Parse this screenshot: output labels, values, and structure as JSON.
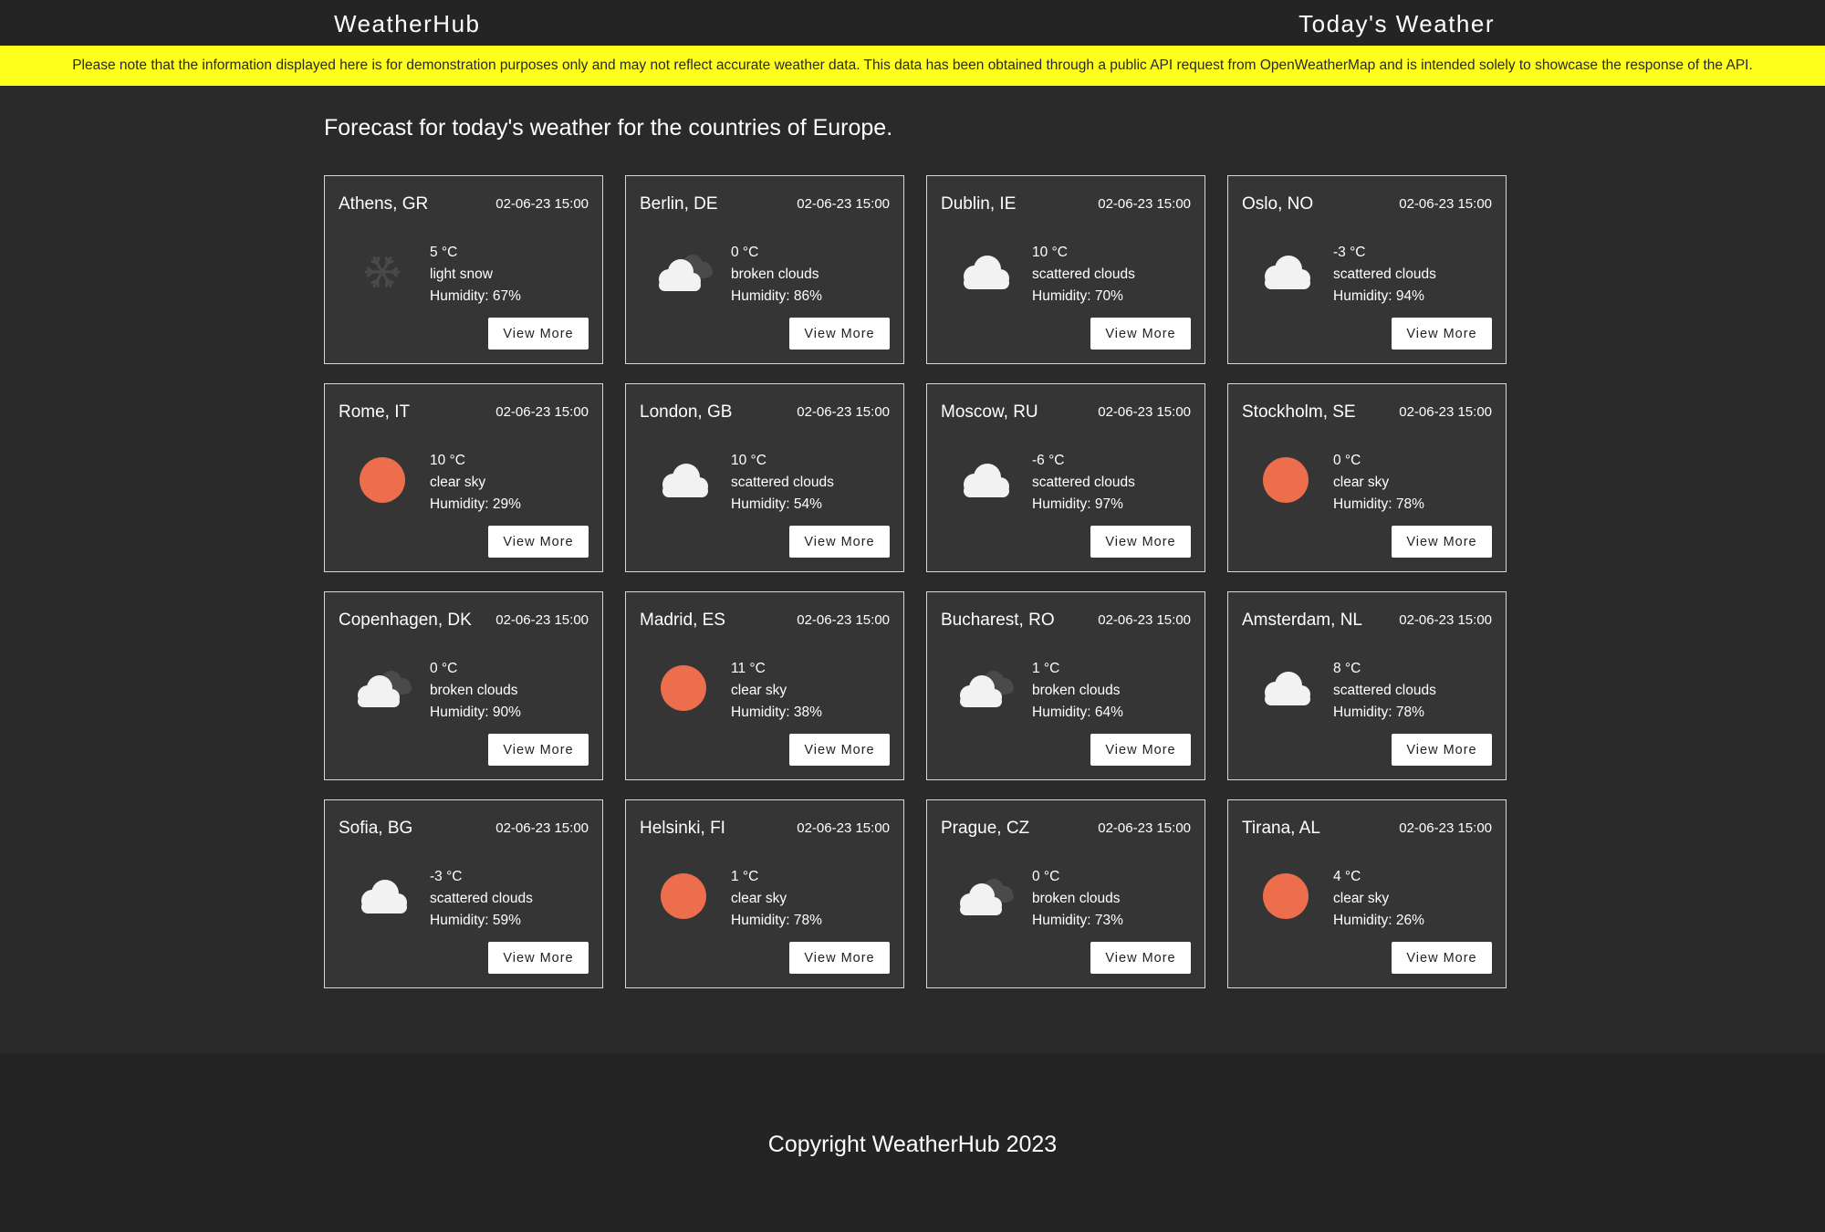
{
  "header": {
    "brand": "WeatherHub",
    "page_title": "Today's Weather"
  },
  "notice": {
    "text": "Please note that the information displayed here is for demonstration purposes only and may not reflect accurate weather data. This data has been obtained through a public API request from OpenWeatherMap and is intended solely to showcase the response of the API.",
    "background": "#ffff1e"
  },
  "main": {
    "subtitle": "Forecast for today's weather for the countries of Europe."
  },
  "colors": {
    "background": "#2a2a2a",
    "card": "#353535",
    "sun": "#ec6e4c",
    "cloud": "#f2f2f2"
  },
  "cards": [
    {
      "city": "Athens, GR",
      "datetime": "02-06-23 15:00",
      "temp": "5 °C",
      "desc": "light snow",
      "humidity": "Humidity: 67%",
      "icon": "snow-icon",
      "button": "View More"
    },
    {
      "city": "Berlin, DE",
      "datetime": "02-06-23 15:00",
      "temp": "0 °C",
      "desc": "broken clouds",
      "humidity": "Humidity: 86%",
      "icon": "broken-clouds-icon",
      "button": "View More"
    },
    {
      "city": "Dublin, IE",
      "datetime": "02-06-23 15:00",
      "temp": "10 °C",
      "desc": "scattered clouds",
      "humidity": "Humidity: 70%",
      "icon": "cloud-icon",
      "button": "View More"
    },
    {
      "city": "Oslo, NO",
      "datetime": "02-06-23 15:00",
      "temp": "-3 °C",
      "desc": "scattered clouds",
      "humidity": "Humidity: 94%",
      "icon": "cloud-icon",
      "button": "View More"
    },
    {
      "city": "Rome, IT",
      "datetime": "02-06-23 15:00",
      "temp": "10 °C",
      "desc": "clear sky",
      "humidity": "Humidity: 29%",
      "icon": "sun-icon",
      "button": "View More"
    },
    {
      "city": "London, GB",
      "datetime": "02-06-23 15:00",
      "temp": "10 °C",
      "desc": "scattered clouds",
      "humidity": "Humidity: 54%",
      "icon": "cloud-icon",
      "button": "View More"
    },
    {
      "city": "Moscow, RU",
      "datetime": "02-06-23 15:00",
      "temp": "-6 °C",
      "desc": "scattered clouds",
      "humidity": "Humidity: 97%",
      "icon": "cloud-icon",
      "button": "View More"
    },
    {
      "city": "Stockholm, SE",
      "datetime": "02-06-23 15:00",
      "temp": "0 °C",
      "desc": "clear sky",
      "humidity": "Humidity: 78%",
      "icon": "sun-icon",
      "button": "View More"
    },
    {
      "city": "Copenhagen, DK",
      "datetime": "02-06-23 15:00",
      "temp": "0 °C",
      "desc": "broken clouds",
      "humidity": "Humidity: 90%",
      "icon": "broken-clouds-icon",
      "button": "View More"
    },
    {
      "city": "Madrid, ES",
      "datetime": "02-06-23 15:00",
      "temp": "11 °C",
      "desc": "clear sky",
      "humidity": "Humidity: 38%",
      "icon": "sun-icon",
      "button": "View More"
    },
    {
      "city": "Bucharest, RO",
      "datetime": "02-06-23 15:00",
      "temp": "1 °C",
      "desc": "broken clouds",
      "humidity": "Humidity: 64%",
      "icon": "broken-clouds-icon",
      "button": "View More"
    },
    {
      "city": "Amsterdam, NL",
      "datetime": "02-06-23 15:00",
      "temp": "8 °C",
      "desc": "scattered clouds",
      "humidity": "Humidity: 78%",
      "icon": "cloud-icon",
      "button": "View More"
    },
    {
      "city": "Sofia, BG",
      "datetime": "02-06-23 15:00",
      "temp": "-3 °C",
      "desc": "scattered clouds",
      "humidity": "Humidity: 59%",
      "icon": "cloud-icon",
      "button": "View More"
    },
    {
      "city": "Helsinki, FI",
      "datetime": "02-06-23 15:00",
      "temp": "1 °C",
      "desc": "clear sky",
      "humidity": "Humidity: 78%",
      "icon": "sun-icon",
      "button": "View More"
    },
    {
      "city": "Prague, CZ",
      "datetime": "02-06-23 15:00",
      "temp": "0 °C",
      "desc": "broken clouds",
      "humidity": "Humidity: 73%",
      "icon": "broken-clouds-icon",
      "button": "View More"
    },
    {
      "city": "Tirana, AL",
      "datetime": "02-06-23 15:00",
      "temp": "4 °C",
      "desc": "clear sky",
      "humidity": "Humidity: 26%",
      "icon": "sun-icon",
      "button": "View More"
    }
  ],
  "footer": {
    "copyright": "Copyright WeatherHub 2023"
  }
}
